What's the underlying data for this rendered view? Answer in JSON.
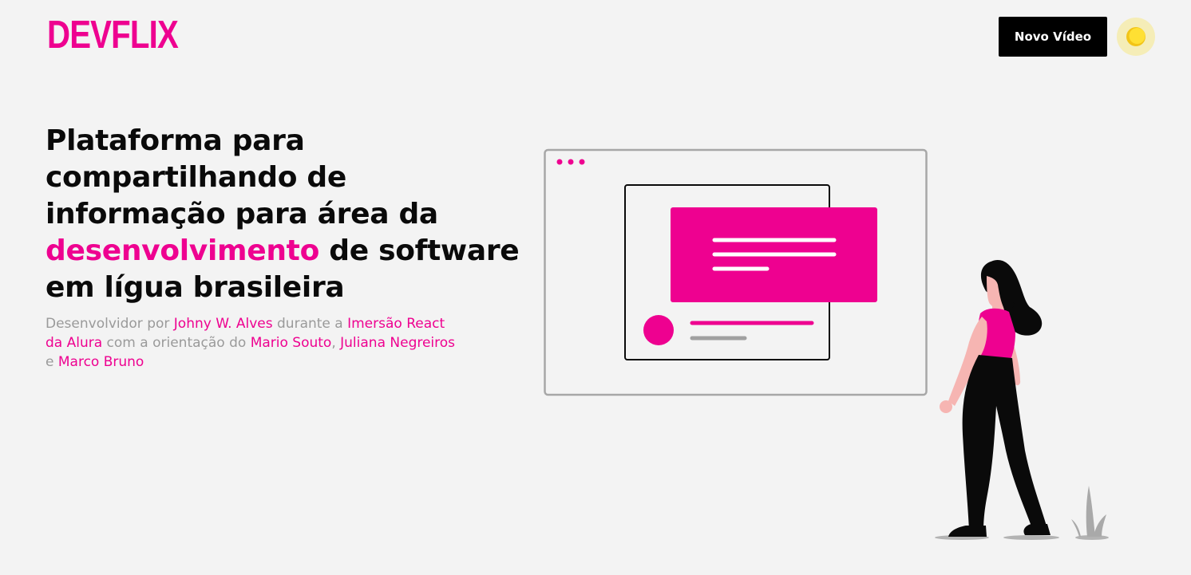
{
  "header": {
    "logo_text": "DEVFLIX",
    "new_video_label": "Novo Vídeo",
    "theme_toggle_icon": "sun-icon"
  },
  "hero": {
    "title_part1": "Plataforma para compartilhando de informação para área da ",
    "title_highlight": "desenvolvimento",
    "title_part2": " de software em lígua brasileira",
    "credits": {
      "t1": "Desenvolvidor por ",
      "author": "Johny W. Alves",
      "t2": " durante a ",
      "event": "Imersão React da Alura",
      "t3": " com a orientação do ",
      "mentor1": "Mario Souto",
      "t4": ", ",
      "mentor2": "Juliana Negreiros",
      "t5": " e ",
      "mentor3": "Marco Bruno"
    }
  },
  "colors": {
    "accent": "#ee0190",
    "background": "#f3f3f3",
    "text": "#0a0a0a",
    "muted": "#9a9a9a",
    "sun": "#fdd835"
  },
  "illustration_icon": "woman-viewing-screen-illustration"
}
